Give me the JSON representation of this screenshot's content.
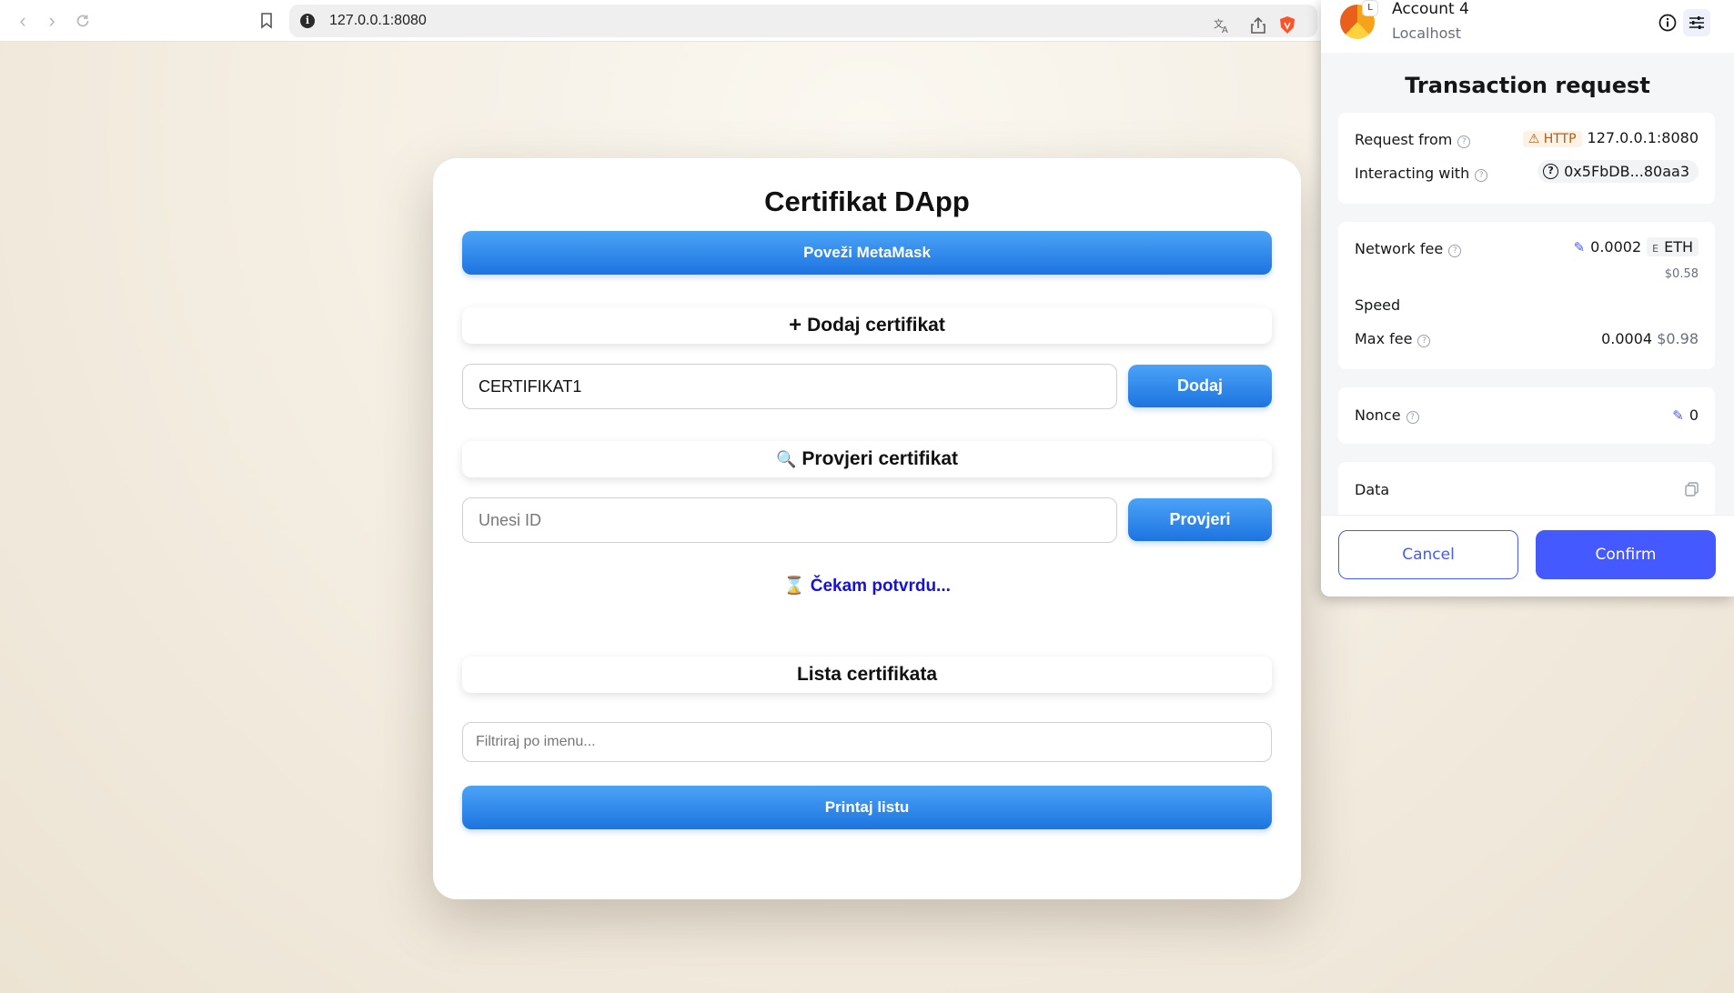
{
  "browser": {
    "url": "127.0.0.1:8080",
    "icons": [
      "back-icon",
      "forward-icon",
      "reload-icon",
      "bookmark-icon",
      "info-icon",
      "translate-icon",
      "share-icon",
      "brave-shield-icon"
    ]
  },
  "dapp": {
    "title": "Certifikat DApp",
    "connect_button": "Poveži MetaMask",
    "add_section": {
      "icon": "+",
      "title": "Dodaj certifikat"
    },
    "add_input": {
      "value": "CERTIFIKAT1"
    },
    "add_button": "Dodaj",
    "verify_section": {
      "icon": "🔍",
      "title": "Provjeri certifikat"
    },
    "verify_input": {
      "placeholder": "Unesi ID"
    },
    "verify_button": "Provjeri",
    "status": {
      "icon": "⌛",
      "text": "Čekam potvrdu..."
    },
    "list_section": {
      "title": "Lista certifikata"
    },
    "filter_input": {
      "placeholder": "Filtriraj po imenu..."
    },
    "print_button": "Printaj listu",
    "accent_color": "#1d74e0"
  },
  "metamask": {
    "account_name": "Account 4",
    "network": "Localhost",
    "avatar_badge": "L",
    "title": "Transaction request",
    "request_from": {
      "label": "Request from",
      "badge": "HTTP",
      "value": "127.0.0.1:8080"
    },
    "interacting_with": {
      "label": "Interacting with",
      "value": "0x5FbDB...80aa3"
    },
    "network_fee": {
      "label": "Network fee",
      "value": "0.0002",
      "currency_icon": "E",
      "currency": "ETH",
      "fiat": "$0.58"
    },
    "speed": {
      "label": "Speed"
    },
    "max_fee": {
      "label": "Max fee",
      "value": "0.0004",
      "fiat": "$0.98"
    },
    "nonce": {
      "label": "Nonce",
      "value": "0"
    },
    "data": {
      "label": "Data"
    },
    "cancel_button": "Cancel",
    "confirm_button": "Confirm",
    "accent_color": "#4459ff"
  }
}
